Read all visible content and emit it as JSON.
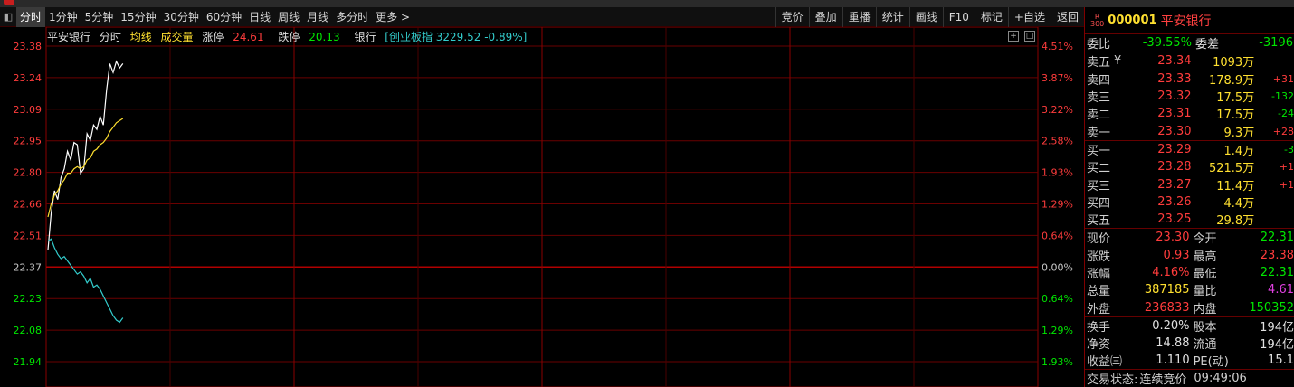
{
  "toolbar": {
    "tabs": [
      "分时",
      "1分钟",
      "5分钟",
      "15分钟",
      "30分钟",
      "60分钟",
      "日线",
      "周线",
      "月线",
      "多分时",
      "更多 >"
    ],
    "tools": [
      "竞价",
      "叠加",
      "重播",
      "统计",
      "画线",
      "F10",
      "标记",
      "+自选",
      "返回"
    ]
  },
  "info": {
    "stock": "平安银行",
    "mode": "分时",
    "avg_label": "均线",
    "vol_label": "成交量",
    "limit_up_label": "涨停",
    "limit_up": "24.61",
    "limit_down_label": "跌停",
    "limit_down": "20.13",
    "sector": "银行",
    "index_text": "[创业板指 3229.52 -0.89%]"
  },
  "chart_data": {
    "type": "line",
    "title": "",
    "prev_close": 22.37,
    "ylim": [
      21.94,
      23.38
    ],
    "y_ticks": [
      "23.38",
      "23.24",
      "23.09",
      "22.95",
      "22.80",
      "22.66",
      "22.51",
      "22.37",
      "22.23",
      "22.08",
      "21.94"
    ],
    "pct_ticks": [
      "4.51%",
      "3.87%",
      "3.22%",
      "2.58%",
      "1.93%",
      "1.29%",
      "0.64%",
      "0.00%",
      "0.64%",
      "1.29%",
      "1.93%"
    ],
    "series": [
      {
        "name": "price",
        "color": "#ffffff",
        "values": [
          22.45,
          22.62,
          22.72,
          22.68,
          22.78,
          22.82,
          22.9,
          22.86,
          22.94,
          22.93,
          22.8,
          22.82,
          22.98,
          22.95,
          23.02,
          23.0,
          23.06,
          23.02,
          23.18,
          23.3,
          23.26,
          23.31,
          23.28,
          23.3
        ]
      },
      {
        "name": "avg",
        "color": "#ffe030",
        "values": [
          22.6,
          22.66,
          22.7,
          22.72,
          22.75,
          22.77,
          22.8,
          22.8,
          22.82,
          22.83,
          22.82,
          22.83,
          22.86,
          22.87,
          22.9,
          22.91,
          22.93,
          22.94,
          22.96,
          22.99,
          23.01,
          23.03,
          23.04,
          23.05
        ]
      },
      {
        "name": "index",
        "color": "#33cccc",
        "values": [
          22.49,
          22.5,
          22.46,
          22.43,
          22.41,
          22.42,
          22.4,
          22.38,
          22.36,
          22.34,
          22.35,
          22.33,
          22.3,
          22.32,
          22.28,
          22.29,
          22.27,
          22.24,
          22.21,
          22.18,
          22.15,
          22.13,
          22.12,
          22.14
        ]
      }
    ]
  },
  "panel": {
    "code": "000001",
    "name": "平安银行",
    "badge_top": "R",
    "badge_bottom": "300",
    "wb_label": "委比",
    "wb_value": "-39.55%",
    "wc_label": "委差",
    "wc_value": "-3196",
    "asks": [
      {
        "label": "卖五",
        "price": "23.34",
        "vol": "1093万",
        "chg": ""
      },
      {
        "label": "卖四",
        "price": "23.33",
        "vol": "178.9万",
        "chg": "+31"
      },
      {
        "label": "卖三",
        "price": "23.32",
        "vol": "17.5万",
        "chg": "-132"
      },
      {
        "label": "卖二",
        "price": "23.31",
        "vol": "17.5万",
        "chg": "-24"
      },
      {
        "label": "卖一",
        "price": "23.30",
        "vol": "9.3万",
        "chg": "+28"
      }
    ],
    "ask_marker": "¥",
    "bids": [
      {
        "label": "买一",
        "price": "23.29",
        "vol": "1.4万",
        "chg": "-3"
      },
      {
        "label": "买二",
        "price": "23.28",
        "vol": "521.5万",
        "chg": "+1"
      },
      {
        "label": "买三",
        "price": "23.27",
        "vol": "11.4万",
        "chg": "+1"
      },
      {
        "label": "买四",
        "price": "23.26",
        "vol": "4.4万",
        "chg": ""
      },
      {
        "label": "买五",
        "price": "23.25",
        "vol": "29.8万",
        "chg": ""
      }
    ],
    "quote1": [
      {
        "k1": "现价",
        "v1": "23.30",
        "c1": "r",
        "k2": "今开",
        "v2": "22.31",
        "c2": "g"
      },
      {
        "k1": "涨跌",
        "v1": "0.93",
        "c1": "r",
        "k2": "最高",
        "v2": "23.38",
        "c2": "r"
      },
      {
        "k1": "涨幅",
        "v1": "4.16%",
        "c1": "r",
        "k2": "最低",
        "v2": "22.31",
        "c2": "g"
      },
      {
        "k1": "总量",
        "v1": "387185",
        "c1": "y",
        "k2": "量比",
        "v2": "4.61",
        "c2": "m"
      },
      {
        "k1": "外盘",
        "v1": "236833",
        "c1": "r",
        "k2": "内盘",
        "v2": "150352",
        "c2": "g"
      }
    ],
    "quote2": [
      {
        "k1": "换手",
        "v1": "0.20%",
        "c1": "w",
        "k2": "股本",
        "v2": "194亿",
        "c2": "w"
      },
      {
        "k1": "净资",
        "v1": "14.88",
        "c1": "w",
        "k2": "流通",
        "v2": "194亿",
        "c2": "w"
      },
      {
        "k1": "收益㈢",
        "v1": "1.110",
        "c1": "w",
        "k2": "PE(动)",
        "v2": "15.1",
        "c2": "w"
      }
    ],
    "status_label": "交易状态:",
    "status_value": "连续竞价",
    "time": "09:49:06"
  }
}
